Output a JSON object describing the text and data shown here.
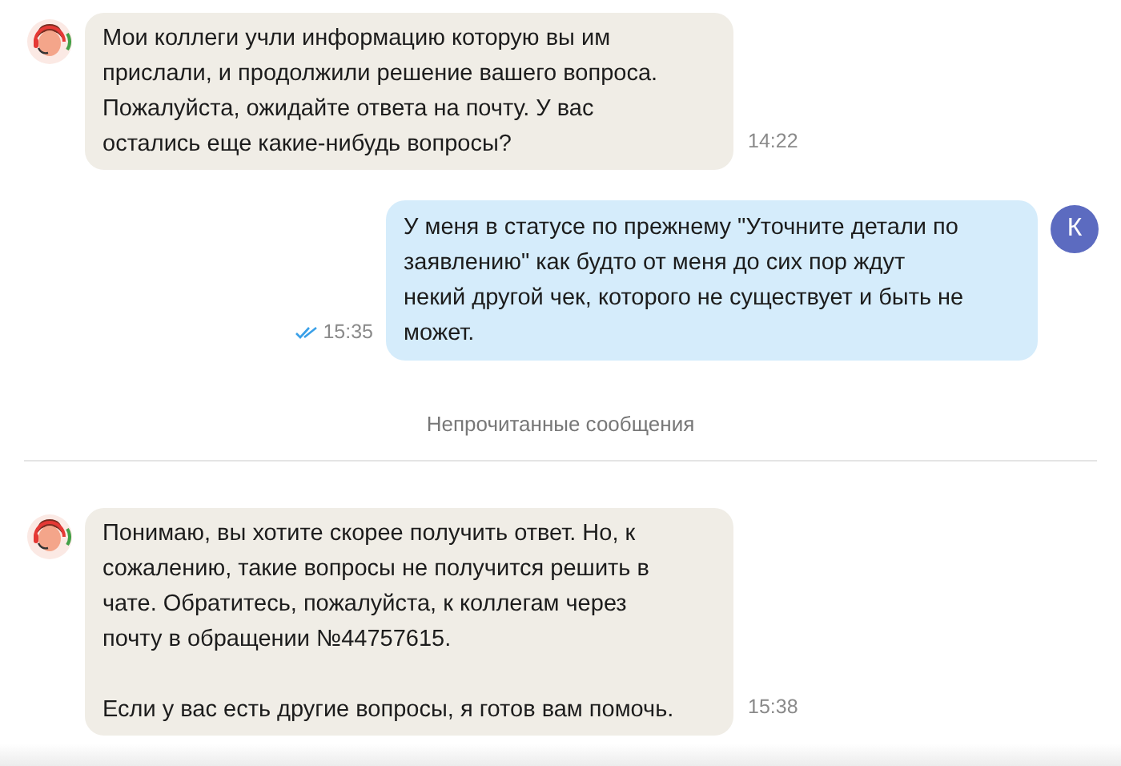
{
  "messages": [
    {
      "kind": "agent",
      "text": "Мои коллеги учли информацию которую вы им\nприслали, и продолжили решение вашего вопроса.\nПожалуйста, ожидайте ответа на почту. У вас\nостались еще какие-нибудь  вопросы?",
      "time": "14:22"
    },
    {
      "kind": "user",
      "avatar": "К",
      "text": "У меня в статусе по прежнему \"Уточните детали по\nзаявлению\" как будто от меня до сих пор ждут\nнекий другой чек, которого не существует и быть не\nможет.",
      "time": "15:35",
      "read": true
    },
    {
      "kind": "divider",
      "text": "Непрочитанные сообщения"
    },
    {
      "kind": "agent",
      "text": "Понимаю, вы хотите скорее получить ответ. Но, к\nсожалению, такие вопросы не получится решить в\nчате. Обратитесь, пожалуйста, к коллегам через\nпочту в обращении №44757615.\n\nЕсли у вас есть другие вопросы, я готов вам помочь.",
      "time": "15:38"
    }
  ]
}
